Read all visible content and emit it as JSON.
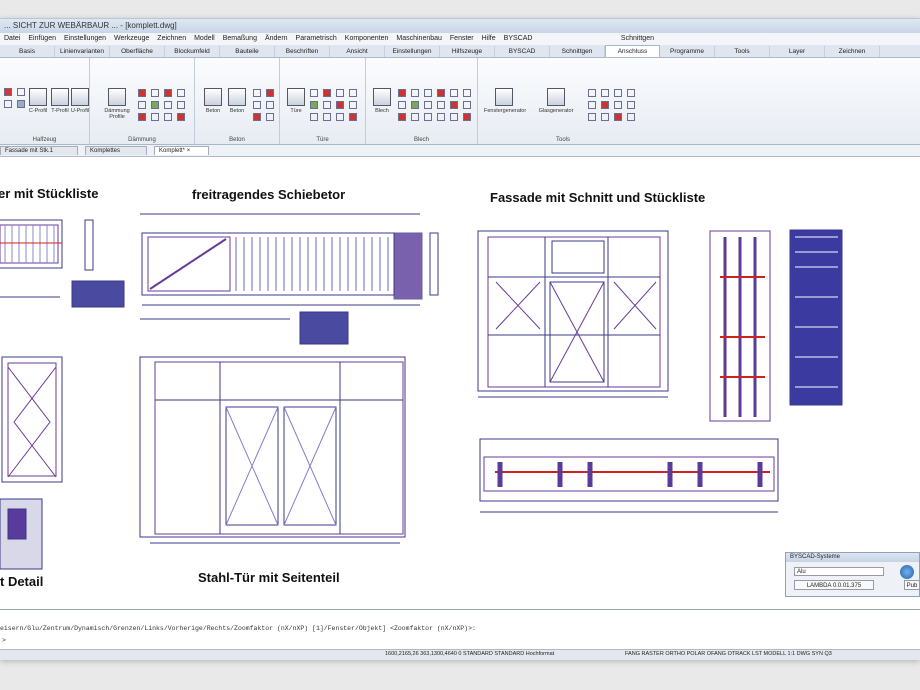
{
  "window": {
    "title": "... SICHT ZUR WEBÄRBAUR ... - [komplett.dwg]"
  },
  "menu": {
    "items": [
      "Datei",
      "Einfügen",
      "Einstellungen",
      "Werkzeuge",
      "Zeichnen",
      "Modell",
      "Bemaßung",
      "Ändern",
      "Parametrisch",
      "Komponenten",
      "Maschinenbau",
      "Fenster",
      "Hilfe",
      "BYSCAD"
    ],
    "right": "Schnittgen"
  },
  "ribbon_tabs": [
    "Basis",
    "Linienvarianten",
    "Oberfläche",
    "Blockumfeld",
    "Bauteile",
    "Beschriften",
    "Ansicht",
    "Einstellungen",
    "Hilfszeuge",
    "BYSCAD",
    "Schnittgen",
    "Anschluss",
    "Programme",
    "Tools",
    "Layer",
    "Zeichnen"
  ],
  "ribbon": {
    "groups": [
      {
        "label": "Halfzeug",
        "buttons": [
          "C-Profil",
          "T-Profil",
          "U-Profil"
        ]
      },
      {
        "label": "Dämmung",
        "buttons": [
          "Dämmung Profile"
        ]
      },
      {
        "label": "Beton",
        "buttons": [
          "Beton",
          "Beton"
        ]
      },
      {
        "label": "Türe",
        "buttons": [
          "Türe"
        ]
      },
      {
        "label": "Blech",
        "buttons": [
          "Blech"
        ]
      },
      {
        "label": "Tools",
        "buttons": [
          "Fenstergenerator",
          "Glasgenerator"
        ]
      }
    ]
  },
  "doc_tabs": [
    "Fassade mit Stk.1",
    "Komplettes",
    "Komplett*"
  ],
  "drawing_titles": {
    "t1": "er mit Stückliste",
    "t2": "freitragendes Schiebetor",
    "t3": "Fassade mit Schnitt und Stückliste",
    "t4": "t Detail",
    "t5": "Stahl-Tür mit Seitenteil"
  },
  "palette": {
    "title": "BYSCAD-Systeme",
    "selected": "Alu",
    "button": "LAMBDA 0.0.01.375",
    "button2": "Pub"
  },
  "command": {
    "line": "eisern/Glu/Zentrum/Dynamisch/Grenzen/Links/Vorherige/Rechts/Zoomfaktor (nX/nXP) [1]/Fenster/Objekt] <Zoomfaktor (nX/nXP)>:",
    "prompt": ">"
  },
  "status": {
    "coords": "1600,2165,26  363,1300,4640  0  STANDARD  STANDARD  Hochformat",
    "flags": "FANG  RASTER  ORTHO  POLAR  OFANG  OTRACK  LST  MODELL  1:1  DWG  SYN  Q3"
  },
  "colors": {
    "line": "#3a3a8a",
    "red": "#d02020",
    "purple": "#6a3a9a",
    "accent": "#2a5fa8"
  }
}
